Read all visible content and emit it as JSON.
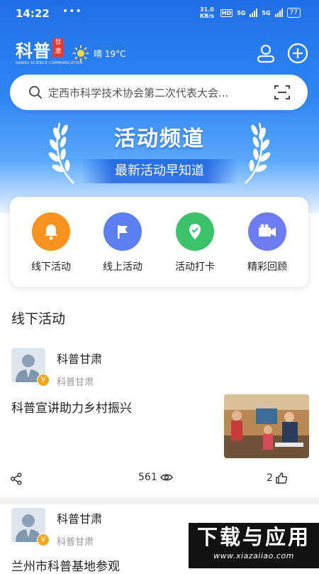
{
  "status_bar": {
    "time": "14:22",
    "dots": "•••",
    "net_speed": "31.0 KB/s",
    "hd": "HD",
    "sig1": "5G",
    "sig2": "5G",
    "battery": "77"
  },
  "header": {
    "logo_text": "科普",
    "logo_sub": "GANSU SCIENCE COMMUNICATION",
    "weather": "晴 19°C",
    "search_placeholder": "定西市科学技术协会第二次代表大会...",
    "banner_title": "活动频道",
    "banner_subtitle": "最新活动早知道"
  },
  "categories": [
    {
      "label": "线下活动",
      "icon": "bell-icon",
      "color": "#f7931e"
    },
    {
      "label": "线上活动",
      "icon": "flag-icon",
      "color": "#5b7ff0"
    },
    {
      "label": "活动打卡",
      "icon": "location-check-icon",
      "color": "#3cc26b"
    },
    {
      "label": "精彩回顾",
      "icon": "video-camera-icon",
      "color": "#6d7cf2"
    }
  ],
  "section_title": "线下活动",
  "posts": [
    {
      "author": "科普甘肃",
      "author_sub": "科普甘肃",
      "title": "科普宣讲助力乡村振兴",
      "views": "561",
      "likes": "2"
    },
    {
      "author": "科普甘肃",
      "author_sub": "科普甘肃",
      "title": "兰州市科普基地参观"
    }
  ],
  "watermark": {
    "text": "下载与应用",
    "url": "www.xiazaiiao.com"
  }
}
